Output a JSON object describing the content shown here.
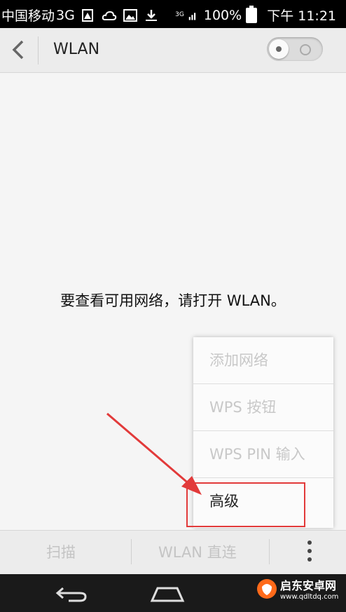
{
  "status_bar": {
    "carrier": "中国移动",
    "network": "3G",
    "signal_label": "3G",
    "battery": "100%",
    "time": "下午 11:21",
    "icons": [
      "warning-icon",
      "cloud-icon",
      "image-icon",
      "download-icon",
      "signal-icon",
      "battery-icon"
    ]
  },
  "app_bar": {
    "title": "WLAN",
    "wlan_toggle": "off"
  },
  "content": {
    "message": "要查看可用网络，请打开 WLAN。"
  },
  "menu": {
    "items": [
      {
        "label": "添加网络",
        "enabled": false
      },
      {
        "label": "WPS 按钮",
        "enabled": false
      },
      {
        "label": "WPS PIN 输入",
        "enabled": false
      },
      {
        "label": "高级",
        "enabled": true
      }
    ]
  },
  "bottom_bar": {
    "scan_label": "扫描",
    "direct_label": "WLAN 直连"
  },
  "watermark": {
    "name": "启东安卓网",
    "url": "www.qdltdq.com"
  },
  "colors": {
    "annotation": "#e23a3a",
    "disabled_text": "#c8c8c8"
  }
}
